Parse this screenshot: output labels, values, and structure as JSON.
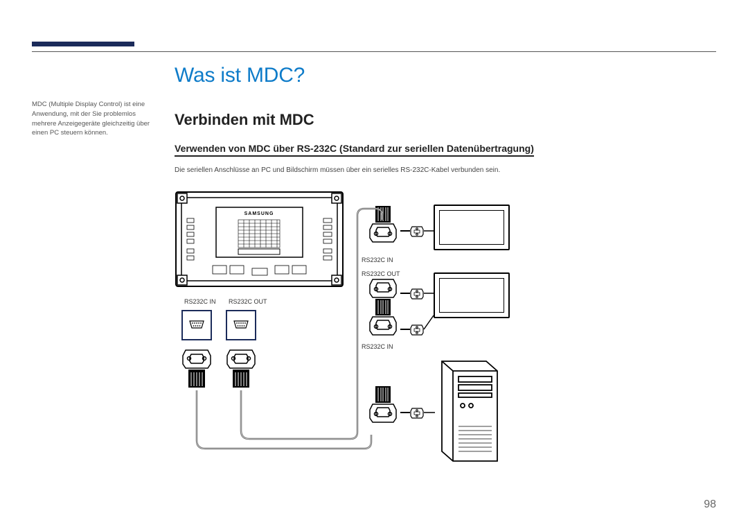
{
  "page": {
    "number": "98"
  },
  "title": "Was ist MDC?",
  "sidebar": {
    "note": "MDC (Multiple Display Control) ist eine Anwendung, mit der Sie problemlos mehrere Anzeigegeräte gleichzeitig über einen PC steuern können."
  },
  "headings": {
    "h2": "Verbinden mit MDC",
    "h3": "Verwenden von MDC über RS-232C (Standard zur seriellen Datenübertragung)"
  },
  "body": {
    "p1": "Die seriellen Anschlüsse an PC und Bildschirm müssen über ein serielles RS-232C-Kabel verbunden sein."
  },
  "diagram": {
    "brand": "SAMSUNG",
    "labels": {
      "in": "RS232C IN",
      "out": "RS232C OUT"
    }
  }
}
